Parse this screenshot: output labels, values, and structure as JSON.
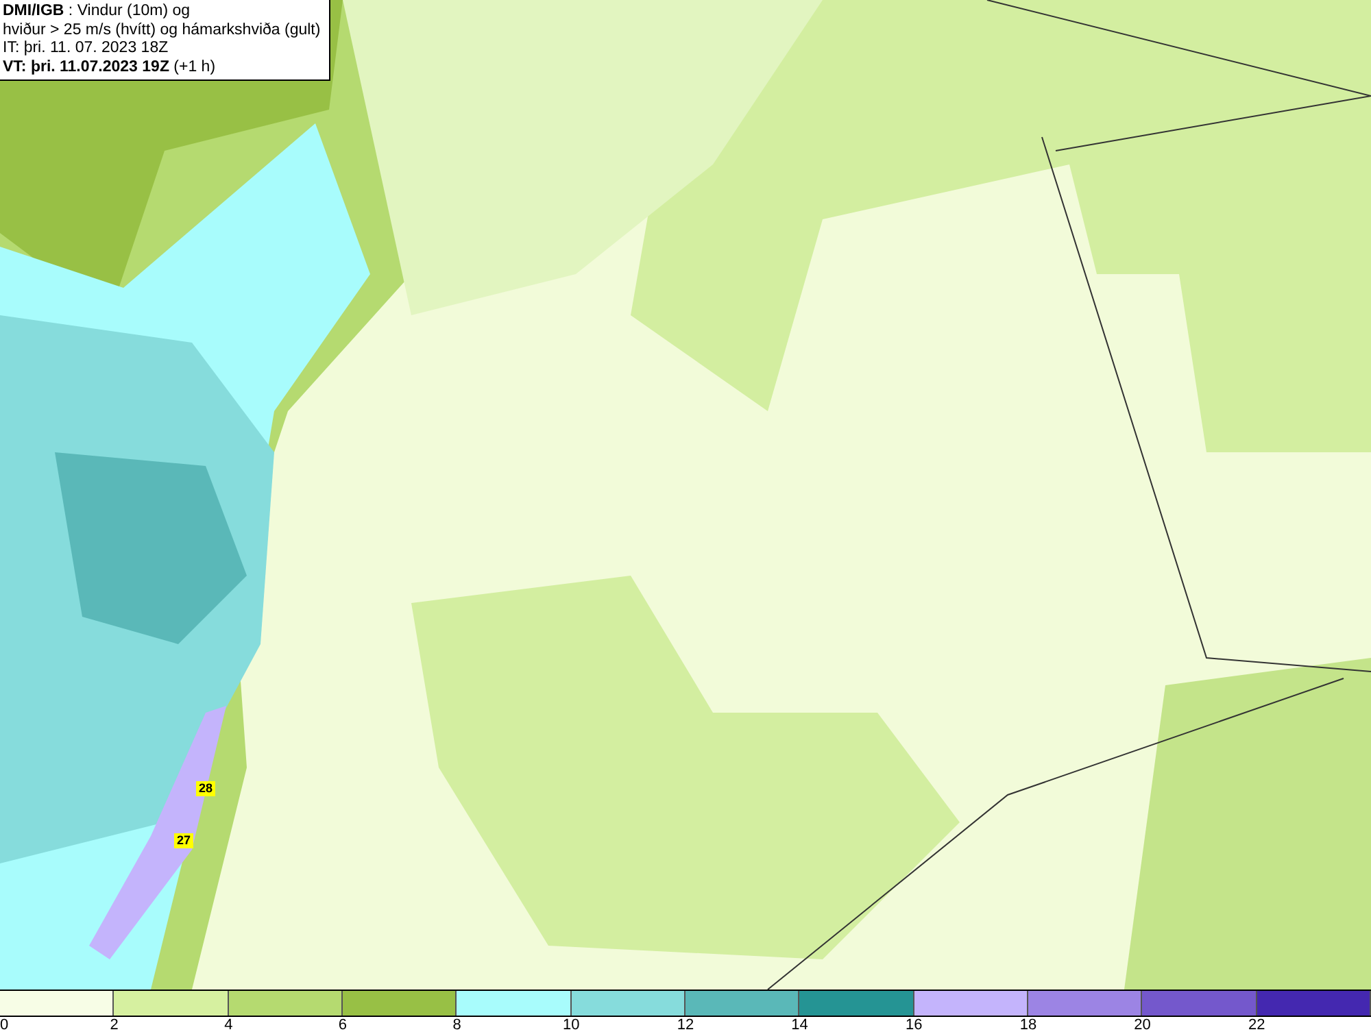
{
  "header": {
    "lines": [
      "**DMI/IGB** : Vindur (10m) og",
      "hviður > 25 m/s (hvítt) og hámarkshviða (gult)",
      "IT: þri. 11. 07. 2023 18Z",
      "**VT: þri. 11.07.2023 19Z** (+1 h)"
    ]
  },
  "map": {
    "gust_labels": [
      "28",
      "27"
    ]
  },
  "legend": {
    "items": [
      {
        "label": "0",
        "color": "#f7fde6"
      },
      {
        "label": "2",
        "color": "#d6f0a0"
      },
      {
        "label": "4",
        "color": "#b5da70"
      },
      {
        "label": "6",
        "color": "#98c045"
      },
      {
        "label": "8",
        "color": "#a8fcfc"
      },
      {
        "label": "10",
        "color": "#86dcdc"
      },
      {
        "label": "12",
        "color": "#5ab8b8"
      },
      {
        "label": "14",
        "color": "#259494"
      },
      {
        "label": "16",
        "color": "#c4b4fc"
      },
      {
        "label": "18",
        "color": "#9c84e4"
      },
      {
        "label": "20",
        "color": "#7458cc"
      },
      {
        "label": "22",
        "color": "#4428b0"
      }
    ]
  }
}
